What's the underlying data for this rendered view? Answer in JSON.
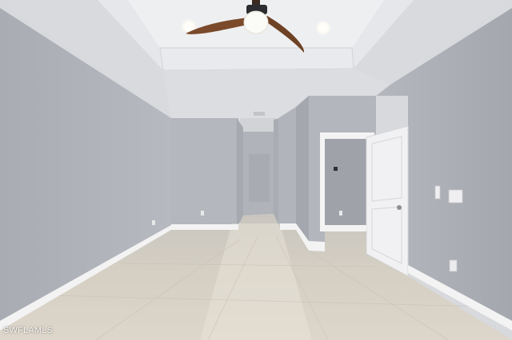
{
  "photo": {
    "subject": "empty-room-interior",
    "watermark": "SWFLAMLS"
  },
  "colors": {
    "wall_left": "#adb0b6",
    "wall_right": "#a7aab1",
    "wall_back": "#b3b6bc",
    "ceiling": "#dfe0e3",
    "floor": "#d9d2c6",
    "baseboard": "#f3f3f3",
    "door": "#f2f2f3",
    "fan_blade": "#7a4a2a"
  },
  "icons": {
    "fan": "ceiling-fan-icon",
    "light": "recessed-light-icon",
    "outlet": "outlet-icon",
    "switch": "light-switch-icon",
    "thermostat": "thermostat-icon"
  }
}
